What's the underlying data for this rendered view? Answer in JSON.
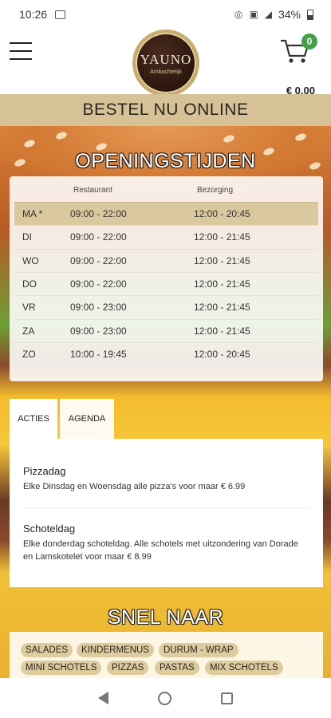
{
  "status": {
    "time": "10:26",
    "battery": "34%"
  },
  "header": {
    "logo_brand": "YAUNO",
    "logo_sub": "Ambachtelijk",
    "cart_count": "0",
    "cart_total": "€ 0.00"
  },
  "banner": {
    "order_label": "BESTEL NU ONLINE"
  },
  "hours": {
    "title": "OPENINGSTIJDEN",
    "col_restaurant": "Restaurant",
    "col_delivery": "Bezorging",
    "rows": [
      {
        "day": "MA *",
        "restaurant": "09:00 - 22:00",
        "delivery": "12:00 - 20:45"
      },
      {
        "day": "DI",
        "restaurant": "09:00 - 22:00",
        "delivery": "12:00 - 21:45"
      },
      {
        "day": "WO",
        "restaurant": "09:00 - 22:00",
        "delivery": "12:00 - 21:45"
      },
      {
        "day": "DO",
        "restaurant": "09:00 - 22:00",
        "delivery": "12:00 - 21:45"
      },
      {
        "day": "VR",
        "restaurant": "09:00 - 23:00",
        "delivery": "12:00 - 21:45"
      },
      {
        "day": "ZA",
        "restaurant": "09:00 - 23:00",
        "delivery": "12:00 - 21:45"
      },
      {
        "day": "ZO",
        "restaurant": "10:00 - 19:45",
        "delivery": "12:00 - 20:45"
      }
    ]
  },
  "tabs": {
    "actions": "ACTIES",
    "agenda": "AGENDA"
  },
  "actions": [
    {
      "title": "Pizzadag",
      "text": "Elke Dinsdag en Woensdag alle pizza's voor maar € 6.99"
    },
    {
      "title": "Schoteldag",
      "text": "Elke donderdag schoteldag. Alle schotels met uitzondering van Dorade en Lamskotelet voor maar € 8.99"
    }
  ],
  "quick": {
    "title": "SNEL NAAR",
    "links": [
      "SALADES",
      "KINDERMENUS",
      "DURUM - WRAP",
      "MINI SCHOTELS",
      "PIZZAS",
      "PASTAS",
      "MIX SCHOTELS"
    ]
  }
}
